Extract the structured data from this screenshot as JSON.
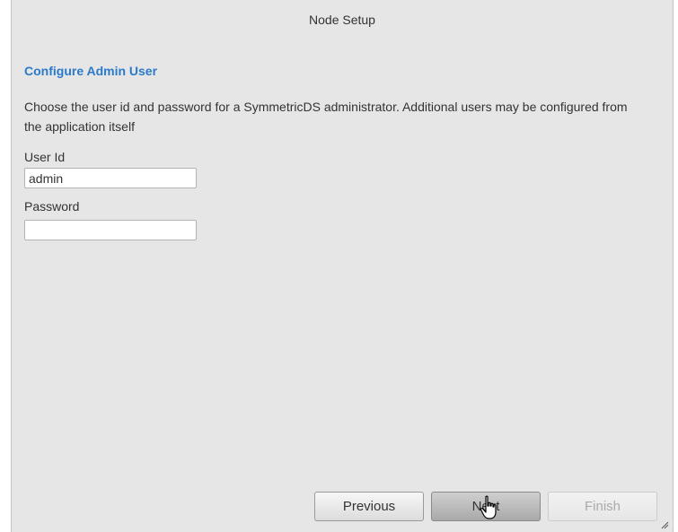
{
  "window": {
    "title": "Node Setup"
  },
  "section": {
    "heading": "Configure Admin User",
    "description": "Choose the user id and password for a SymmetricDS administrator. Additional users may be configured from the application itself"
  },
  "form": {
    "user_id_label": "User Id",
    "user_id_value": "admin",
    "password_label": "Password",
    "password_value": ""
  },
  "buttons": {
    "previous_label": "Previous",
    "next_label": "Next",
    "finish_label": "Finish",
    "finish_enabled": false
  },
  "icons": {
    "cursor": "hand-pointer-icon",
    "resize": "resize-grip-icon"
  },
  "colors": {
    "heading": "#2a7ac9",
    "dialog_background": "#e6e6e6"
  }
}
